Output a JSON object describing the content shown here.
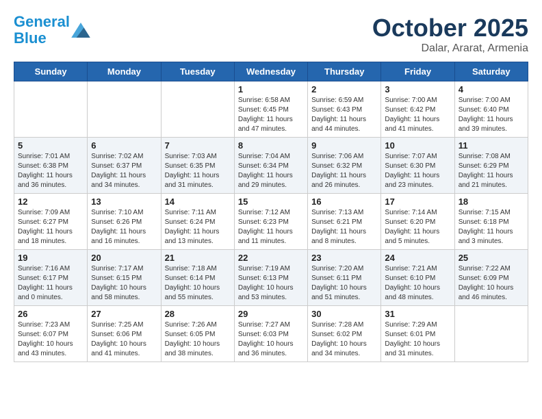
{
  "logo": {
    "line1": "General",
    "line2": "Blue"
  },
  "title": "October 2025",
  "subtitle": "Dalar, Ararat, Armenia",
  "headers": [
    "Sunday",
    "Monday",
    "Tuesday",
    "Wednesday",
    "Thursday",
    "Friday",
    "Saturday"
  ],
  "weeks": [
    [
      {
        "day": "",
        "info": ""
      },
      {
        "day": "",
        "info": ""
      },
      {
        "day": "",
        "info": ""
      },
      {
        "day": "1",
        "info": "Sunrise: 6:58 AM\nSunset: 6:45 PM\nDaylight: 11 hours\nand 47 minutes."
      },
      {
        "day": "2",
        "info": "Sunrise: 6:59 AM\nSunset: 6:43 PM\nDaylight: 11 hours\nand 44 minutes."
      },
      {
        "day": "3",
        "info": "Sunrise: 7:00 AM\nSunset: 6:42 PM\nDaylight: 11 hours\nand 41 minutes."
      },
      {
        "day": "4",
        "info": "Sunrise: 7:00 AM\nSunset: 6:40 PM\nDaylight: 11 hours\nand 39 minutes."
      }
    ],
    [
      {
        "day": "5",
        "info": "Sunrise: 7:01 AM\nSunset: 6:38 PM\nDaylight: 11 hours\nand 36 minutes."
      },
      {
        "day": "6",
        "info": "Sunrise: 7:02 AM\nSunset: 6:37 PM\nDaylight: 11 hours\nand 34 minutes."
      },
      {
        "day": "7",
        "info": "Sunrise: 7:03 AM\nSunset: 6:35 PM\nDaylight: 11 hours\nand 31 minutes."
      },
      {
        "day": "8",
        "info": "Sunrise: 7:04 AM\nSunset: 6:34 PM\nDaylight: 11 hours\nand 29 minutes."
      },
      {
        "day": "9",
        "info": "Sunrise: 7:06 AM\nSunset: 6:32 PM\nDaylight: 11 hours\nand 26 minutes."
      },
      {
        "day": "10",
        "info": "Sunrise: 7:07 AM\nSunset: 6:30 PM\nDaylight: 11 hours\nand 23 minutes."
      },
      {
        "day": "11",
        "info": "Sunrise: 7:08 AM\nSunset: 6:29 PM\nDaylight: 11 hours\nand 21 minutes."
      }
    ],
    [
      {
        "day": "12",
        "info": "Sunrise: 7:09 AM\nSunset: 6:27 PM\nDaylight: 11 hours\nand 18 minutes."
      },
      {
        "day": "13",
        "info": "Sunrise: 7:10 AM\nSunset: 6:26 PM\nDaylight: 11 hours\nand 16 minutes."
      },
      {
        "day": "14",
        "info": "Sunrise: 7:11 AM\nSunset: 6:24 PM\nDaylight: 11 hours\nand 13 minutes."
      },
      {
        "day": "15",
        "info": "Sunrise: 7:12 AM\nSunset: 6:23 PM\nDaylight: 11 hours\nand 11 minutes."
      },
      {
        "day": "16",
        "info": "Sunrise: 7:13 AM\nSunset: 6:21 PM\nDaylight: 11 hours\nand 8 minutes."
      },
      {
        "day": "17",
        "info": "Sunrise: 7:14 AM\nSunset: 6:20 PM\nDaylight: 11 hours\nand 5 minutes."
      },
      {
        "day": "18",
        "info": "Sunrise: 7:15 AM\nSunset: 6:18 PM\nDaylight: 11 hours\nand 3 minutes."
      }
    ],
    [
      {
        "day": "19",
        "info": "Sunrise: 7:16 AM\nSunset: 6:17 PM\nDaylight: 11 hours\nand 0 minutes."
      },
      {
        "day": "20",
        "info": "Sunrise: 7:17 AM\nSunset: 6:15 PM\nDaylight: 10 hours\nand 58 minutes."
      },
      {
        "day": "21",
        "info": "Sunrise: 7:18 AM\nSunset: 6:14 PM\nDaylight: 10 hours\nand 55 minutes."
      },
      {
        "day": "22",
        "info": "Sunrise: 7:19 AM\nSunset: 6:13 PM\nDaylight: 10 hours\nand 53 minutes."
      },
      {
        "day": "23",
        "info": "Sunrise: 7:20 AM\nSunset: 6:11 PM\nDaylight: 10 hours\nand 51 minutes."
      },
      {
        "day": "24",
        "info": "Sunrise: 7:21 AM\nSunset: 6:10 PM\nDaylight: 10 hours\nand 48 minutes."
      },
      {
        "day": "25",
        "info": "Sunrise: 7:22 AM\nSunset: 6:09 PM\nDaylight: 10 hours\nand 46 minutes."
      }
    ],
    [
      {
        "day": "26",
        "info": "Sunrise: 7:23 AM\nSunset: 6:07 PM\nDaylight: 10 hours\nand 43 minutes."
      },
      {
        "day": "27",
        "info": "Sunrise: 7:25 AM\nSunset: 6:06 PM\nDaylight: 10 hours\nand 41 minutes."
      },
      {
        "day": "28",
        "info": "Sunrise: 7:26 AM\nSunset: 6:05 PM\nDaylight: 10 hours\nand 38 minutes."
      },
      {
        "day": "29",
        "info": "Sunrise: 7:27 AM\nSunset: 6:03 PM\nDaylight: 10 hours\nand 36 minutes."
      },
      {
        "day": "30",
        "info": "Sunrise: 7:28 AM\nSunset: 6:02 PM\nDaylight: 10 hours\nand 34 minutes."
      },
      {
        "day": "31",
        "info": "Sunrise: 7:29 AM\nSunset: 6:01 PM\nDaylight: 10 hours\nand 31 minutes."
      },
      {
        "day": "",
        "info": ""
      }
    ]
  ]
}
